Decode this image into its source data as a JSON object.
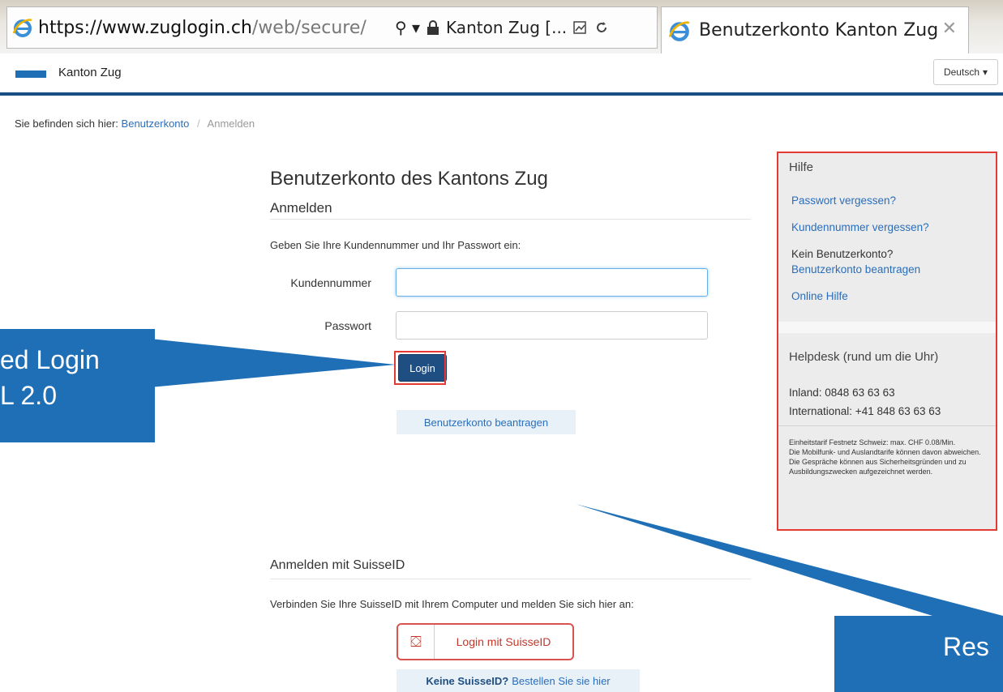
{
  "browser": {
    "url_host": "https://www.zuglogin.ch",
    "url_path": "/web/secure/",
    "search_glyph": "⚲ ▾",
    "site_identity": "Kanton Zug [...",
    "tab_title": "Benutzerkonto Kanton Zug",
    "tab_close": "✕",
    "icons": [
      "ie-logo-icon",
      "search-icon",
      "lock-icon",
      "compat-view-icon",
      "refresh-icon",
      "close-icon"
    ]
  },
  "header": {
    "brand": "Kanton Zug",
    "language": "Deutsch",
    "language_caret": "▾",
    "accent_color": "#1a4f86"
  },
  "breadcrumb": {
    "prefix": "Sie befinden sich hier:",
    "link": "Benutzerkonto",
    "separator": "/",
    "current": "Anmelden"
  },
  "login": {
    "title": "Benutzerkonto des Kantons Zug",
    "section": "Anmelden",
    "instructions": "Geben Sie Ihre Kundennummer und Ihr Passwort ein:",
    "customer_label": "Kundennummer",
    "customer_value": "",
    "password_label": "Passwort",
    "password_value": "",
    "login_button": "Login",
    "request_account_button": "Benutzerkonto beantragen"
  },
  "suisseid": {
    "section": "Anmelden mit SuisseID",
    "instructions": "Verbinden Sie Ihre SuisseID mit Ihrem Computer und melden Sie sich hier an:",
    "button_icon": "⛋",
    "button_label": "Login mit SuisseID",
    "order_bold": "Keine SuisseID?",
    "order_rest": "Bestellen Sie sie hier"
  },
  "sidebar": {
    "help_heading": "Hilfe",
    "forgot_password": "Passwort vergessen?",
    "forgot_customer_number": "Kundennummer vergessen?",
    "no_account": "Kein Benutzerkonto?",
    "request_account": "Benutzerkonto beantragen",
    "online_help": "Online Hilfe",
    "helpdesk_heading": "Helpdesk (rund um die Uhr)",
    "inland": "Inland: 0848 63 63 63",
    "international": "International: +41 848 63 63 63",
    "small_print": "Einheitstarif Festnetz Schweiz: max. CHF 0.08/Min.\nDie Mobilfunk- und Auslandtarife können davon abweichen. Die Gespräche können aus Sicherheitsgründen und zu Ausbildungszwecken aufgezeichnet werden."
  },
  "callouts": {
    "left_line1": "ed Login",
    "left_line2": "L 2.0",
    "right": "Res",
    "color": "#1f6fb6"
  }
}
